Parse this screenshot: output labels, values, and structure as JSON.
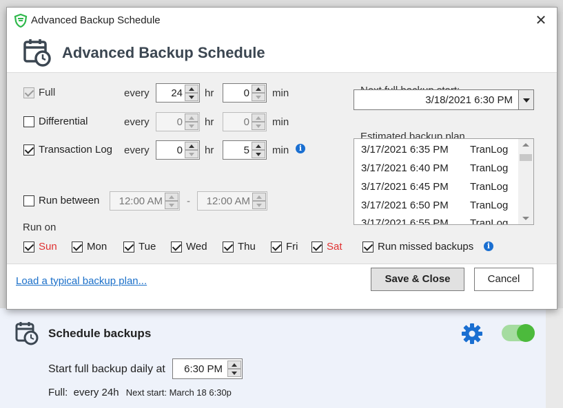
{
  "window": {
    "title": "Advanced Backup Schedule",
    "close_glyph": "✕"
  },
  "header": {
    "title": "Advanced Backup Schedule"
  },
  "schedule": {
    "every_label": "every",
    "hr_label": "hr",
    "min_label": "min",
    "full": {
      "label": "Full",
      "checked": true,
      "disabled": true,
      "hours": "24",
      "minutes": "0"
    },
    "differential": {
      "label": "Differential",
      "checked": false,
      "hours": "0",
      "minutes": "0"
    },
    "transaction_log": {
      "label": "Transaction Log",
      "checked": true,
      "hours": "0",
      "minutes": "5"
    },
    "run_between": {
      "label": "Run between",
      "checked": false,
      "start": "12:00 AM",
      "separator": "-",
      "end": "12:00 AM"
    },
    "run_on_label": "Run on",
    "days": [
      {
        "label": "Sun",
        "checked": true,
        "weekend": true
      },
      {
        "label": "Mon",
        "checked": true,
        "weekend": false
      },
      {
        "label": "Tue",
        "checked": true,
        "weekend": false
      },
      {
        "label": "Wed",
        "checked": true,
        "weekend": false
      },
      {
        "label": "Thu",
        "checked": true,
        "weekend": false
      },
      {
        "label": "Fri",
        "checked": true,
        "weekend": false
      },
      {
        "label": "Sat",
        "checked": true,
        "weekend": true
      }
    ],
    "run_missed": {
      "label": "Run missed backups",
      "checked": true
    }
  },
  "next_full": {
    "label": "Next full backup start:",
    "value": "3/18/2021 6:30 PM"
  },
  "plan": {
    "label": "Estimated backup plan",
    "rows": [
      {
        "time": "3/17/2021 6:35 PM",
        "type": "TranLog"
      },
      {
        "time": "3/17/2021 6:40 PM",
        "type": "TranLog"
      },
      {
        "time": "3/17/2021 6:45 PM",
        "type": "TranLog"
      },
      {
        "time": "3/17/2021 6:50 PM",
        "type": "TranLog"
      },
      {
        "time": "3/17/2021 6:55 PM",
        "type": "TranLog"
      }
    ]
  },
  "footer": {
    "link": "Load a typical backup plan...",
    "save": "Save & Close",
    "cancel": "Cancel"
  },
  "background": {
    "title": "Schedule backups",
    "start_label": "Start full backup daily at",
    "start_time": "6:30 PM",
    "full_text": "Full:  every 24h",
    "next_start": "Next start: March 18 6:30p",
    "enabled": true
  },
  "colors": {
    "accent": "#1a6fd1",
    "weekend": "#e03030",
    "toggle_on": "#4cba3c",
    "brand_green": "#2eb84b"
  }
}
